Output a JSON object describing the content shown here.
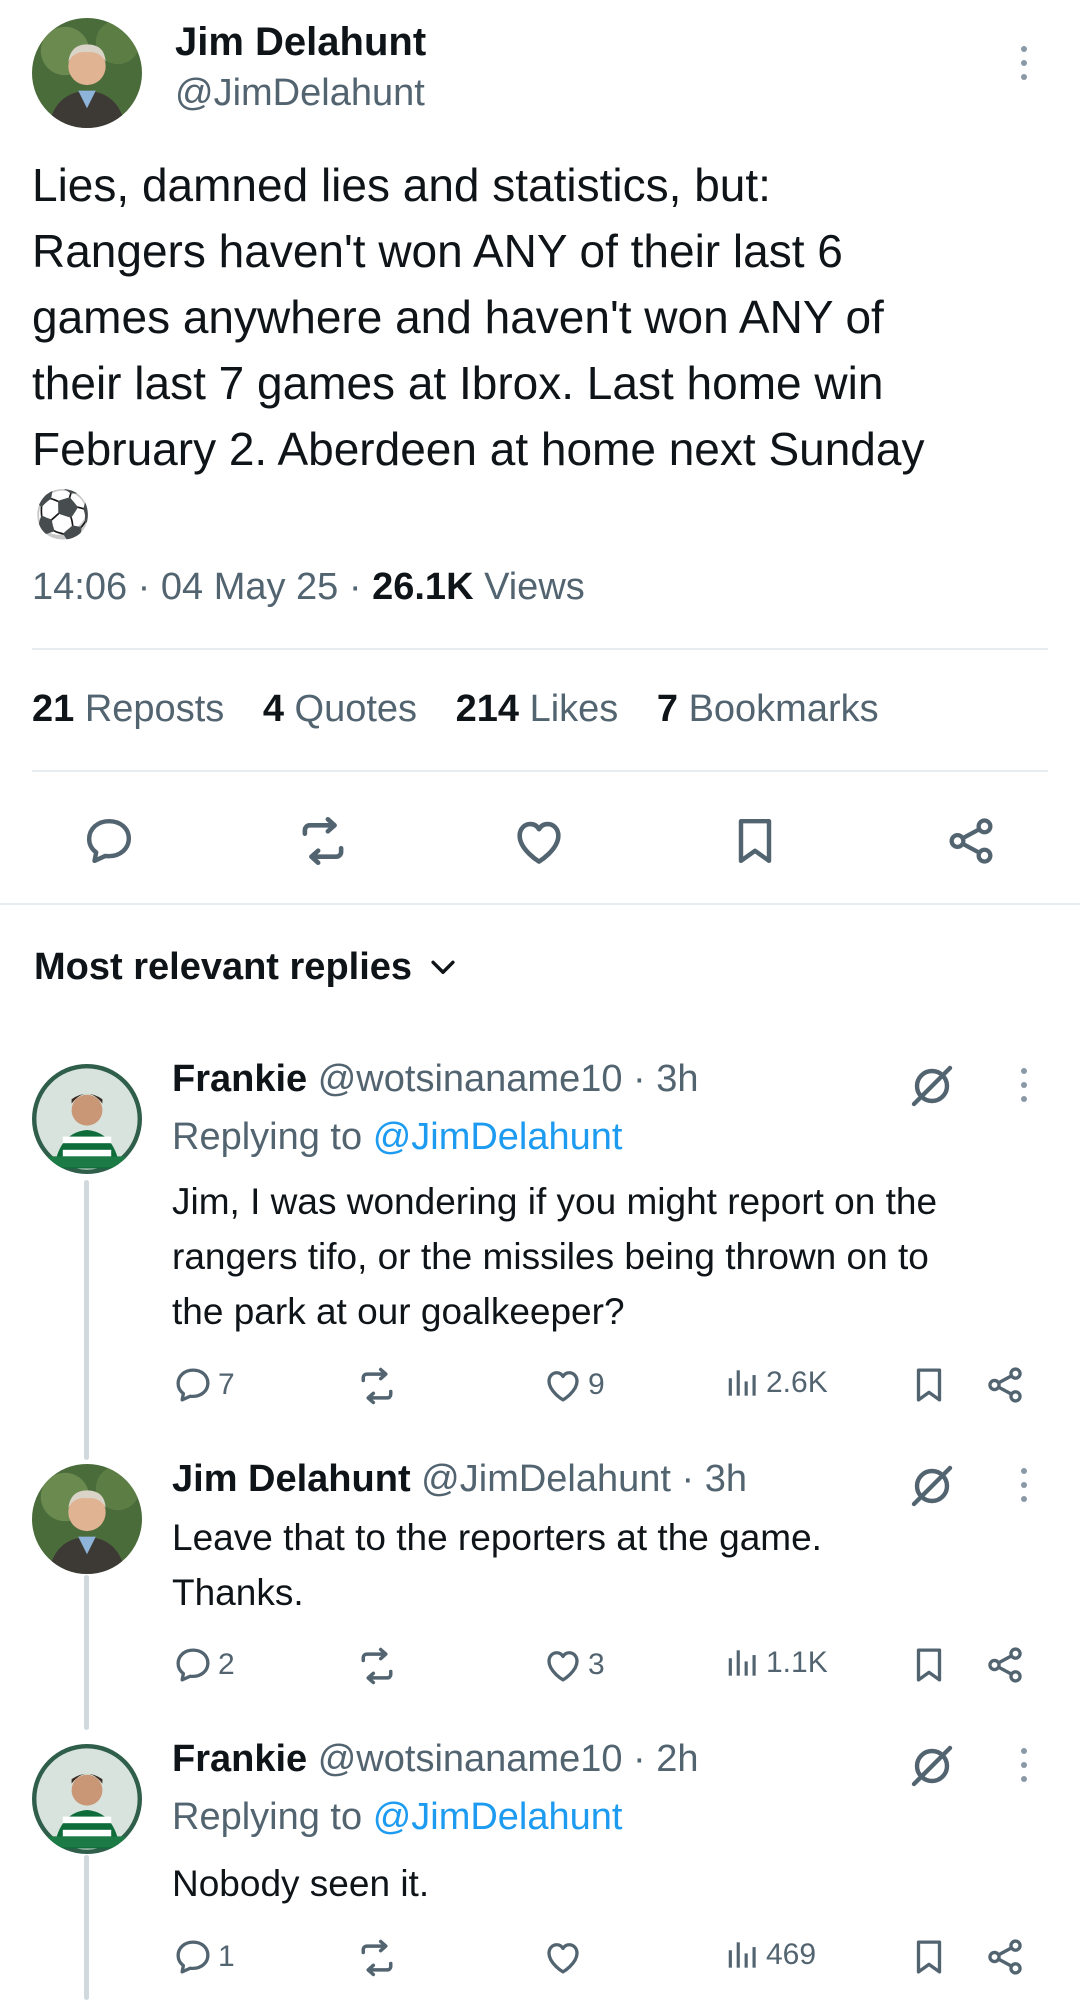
{
  "tweet": {
    "author_name": "Jim Delahunt",
    "author_handle": "@JimDelahunt",
    "text_lines": [
      "Lies, damned lies and statistics, but:",
      "Rangers haven't won ANY of their last 6",
      "games anywhere and haven't won ANY of",
      "their last 7 games at Ibrox. Last home win",
      "February 2. Aberdeen at home next Sunday"
    ],
    "emoji": "⚽",
    "time": "14:06",
    "date": "04 May 25",
    "sep": "·",
    "views_count": "26.1K",
    "views_label": "Views"
  },
  "stats": {
    "reposts_count": "21",
    "reposts_label": "Reposts",
    "quotes_count": "4",
    "quotes_label": "Quotes",
    "likes_count": "214",
    "likes_label": "Likes",
    "bookmarks_count": "7",
    "bookmarks_label": "Bookmarks"
  },
  "replies_header": {
    "label": "Most relevant replies"
  },
  "replies": [
    {
      "name": "Frankie",
      "handle": "@wotsinaname10",
      "time": "3h",
      "replying_label": "Replying to",
      "replying_to": "@JimDelahunt",
      "lines": [
        "Jim, I was wondering if you might report on the",
        "rangers tifo, or the missiles being thrown on to",
        "the park at our goalkeeper?"
      ],
      "replies": "7",
      "likes": "9",
      "views": "2.6K"
    },
    {
      "name": "Jim Delahunt",
      "handle": "@JimDelahunt",
      "time": "3h",
      "lines": [
        "Leave that to the reporters at the game.",
        "Thanks."
      ],
      "replies": "2",
      "likes": "3",
      "views": "1.1K"
    },
    {
      "name": "Frankie",
      "handle": "@wotsinaname10",
      "time": "2h",
      "replying_label": "Replying to",
      "replying_to": "@JimDelahunt",
      "lines": [
        "Nobody seen it."
      ],
      "replies": "1",
      "likes": "",
      "views": "469"
    }
  ],
  "colors": {
    "accent": "#1d9bf0",
    "text": "#0f1419",
    "muted": "#536471",
    "divider": "#e6ecf0"
  }
}
